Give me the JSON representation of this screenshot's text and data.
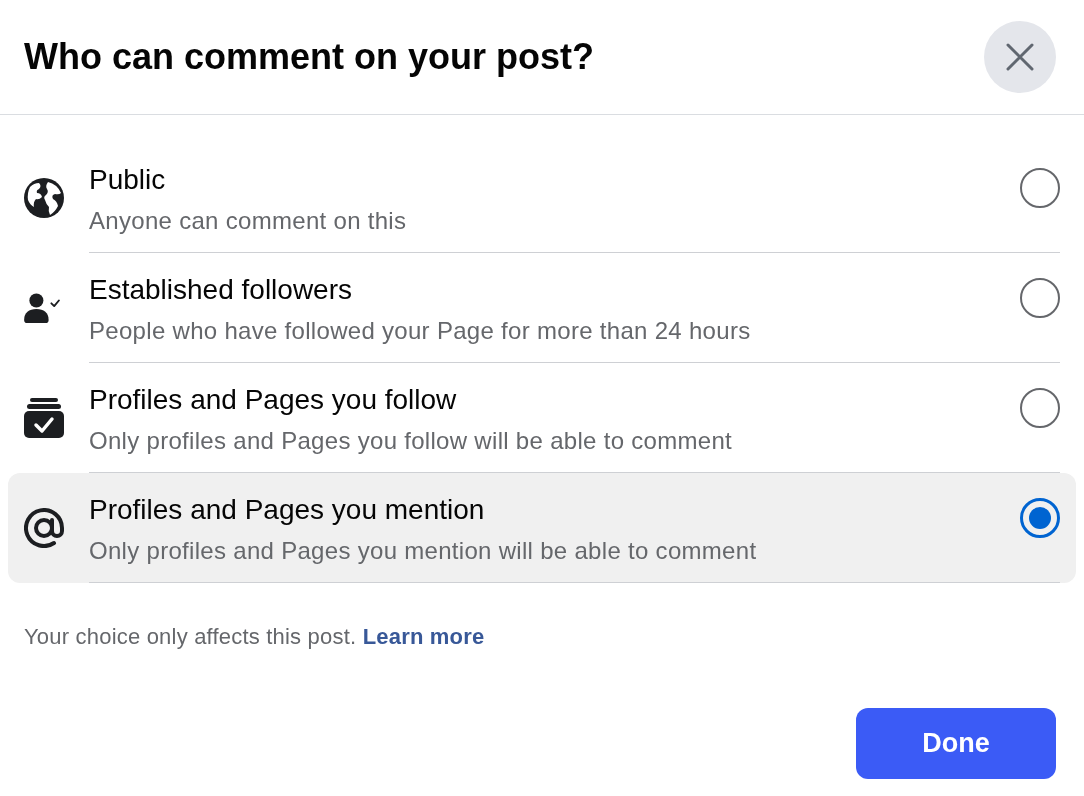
{
  "dialog": {
    "title": "Who can comment on your post?"
  },
  "options": [
    {
      "kind": "globe",
      "label": "Public",
      "description": "Anyone can comment on this",
      "selected": false
    },
    {
      "kind": "person",
      "label": "Established followers",
      "description": "People who have followed your Page for more than 24 hours",
      "selected": false
    },
    {
      "kind": "archive",
      "label": "Profiles and Pages you follow",
      "description": "Only profiles and Pages you follow will be able to comment",
      "selected": false
    },
    {
      "kind": "at",
      "label": "Profiles and Pages you mention",
      "description": "Only profiles and Pages you mention will be able to comment",
      "selected": true
    }
  ],
  "footer": {
    "note": "Your choice only affects this post.",
    "link": "Learn more"
  },
  "buttons": [
    {
      "label": "Done"
    }
  ]
}
